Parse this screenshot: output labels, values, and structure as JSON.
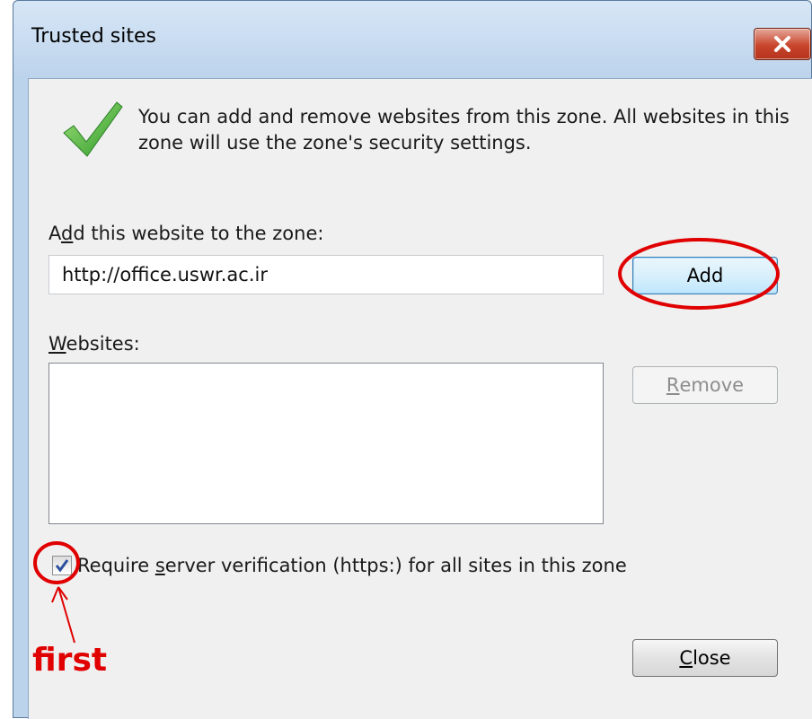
{
  "window": {
    "title": "Trusted sites",
    "close_icon": "close-icon"
  },
  "info": {
    "text": "You can add and remove websites from this zone. All websites in this zone will use the zone's security settings.",
    "icon": "checkmark-icon"
  },
  "add": {
    "label_pre": "A",
    "label_ul": "d",
    "label_post": "d this website to the zone:",
    "url_value": "http://office.uswr.ac.ir",
    "button_label": "Add"
  },
  "websites": {
    "label_ul": "W",
    "label_post": "ebsites:",
    "items": [],
    "remove_ul": "R",
    "remove_post": "emove"
  },
  "verification": {
    "checked": true,
    "label_pre": "Require ",
    "label_ul": "s",
    "label_post": "erver verification (https:) for all sites in this zone"
  },
  "footer": {
    "close_ul": "C",
    "close_post": "lose"
  },
  "annotation": {
    "text": "first",
    "color": "#e00000"
  }
}
